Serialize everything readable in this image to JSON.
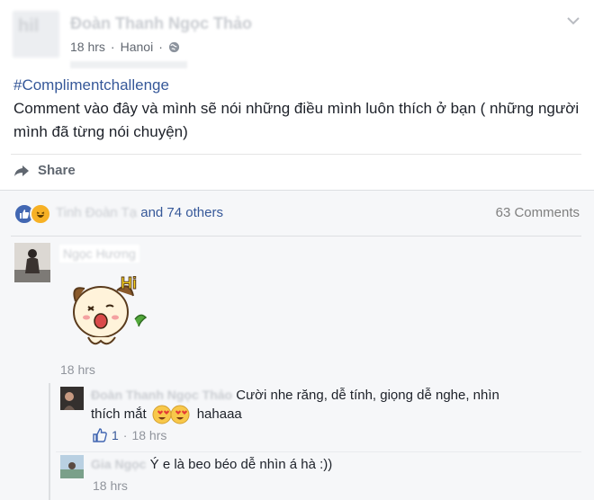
{
  "post": {
    "author": "Đoàn Thanh Ngọc Thảo",
    "time": "18 hrs",
    "separator": "·",
    "location": "Hanoi",
    "hashtag": "#Complimentchallenge",
    "text": "Comment vào đây và mình sẽ nói những điều mình luôn thích ở bạn ( những người mình đã từng nói chuyện)"
  },
  "actions": {
    "share_label": "Share"
  },
  "reactions": {
    "names": "Tinh Đoàn Tạ",
    "others": "and 74 others",
    "comment_count": "63 Comments",
    "like_color": "#4267b2",
    "haha_color": "#f7b125"
  },
  "comments": [
    {
      "author": "Ngọc Hương",
      "sticker": "Hi",
      "time": "18 hrs"
    }
  ],
  "replies": [
    {
      "author": "Đoàn Thanh Ngọc Thảo",
      "text_a": "Cười nhe răng, dễ tính, giọng dễ nghe, nhìn",
      "text_b": "thích mắt",
      "text_c": "hahaaa",
      "likes": "1",
      "separator": "·",
      "time": "18 hrs"
    },
    {
      "author": "Gia Ngọc",
      "text": "Ý e là beo béo dễ nhìn á hà :))",
      "time": "18 hrs"
    }
  ],
  "icons": {
    "globe": "globe-icon",
    "chevron": "chevron-down-icon",
    "share": "share-arrow-icon",
    "like": "like-reaction-icon",
    "haha": "haha-reaction-icon",
    "thumb": "thumbs-up-icon"
  }
}
